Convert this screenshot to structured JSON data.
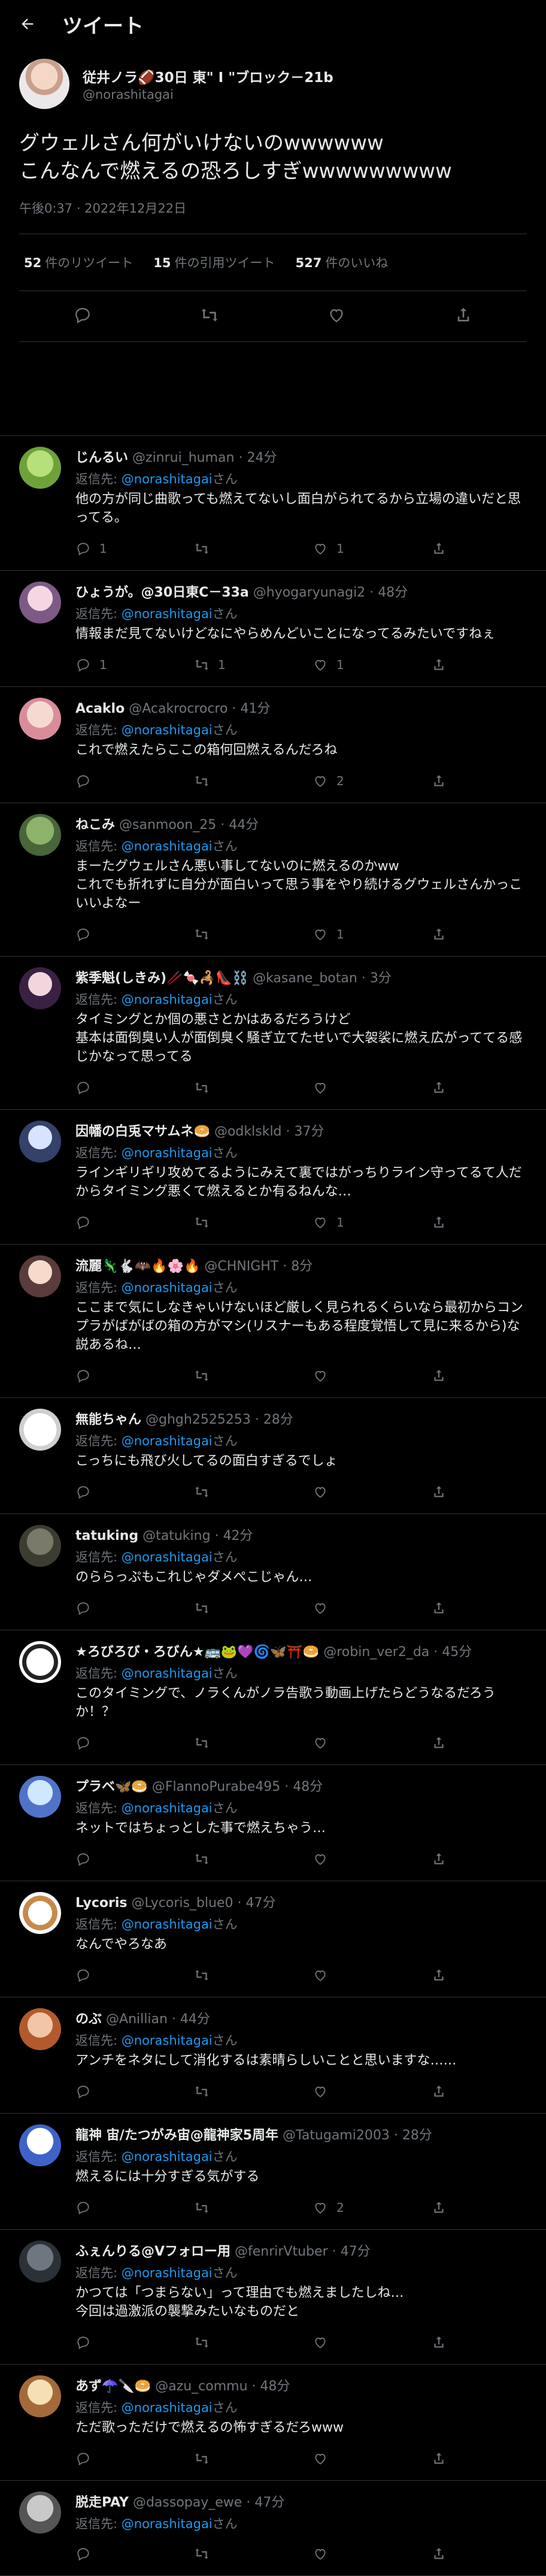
{
  "header": {
    "title": "ツイート"
  },
  "tweet": {
    "author_name": "従井ノラ🏈30日 東\" I \"ブロック－21b",
    "author_handle": "@norashitagai",
    "text": "グウェルさん何がいけないのwwwwww\nこんなんで燃えるの恐ろしすぎwwwwwwwww",
    "timestamp": "午後0:37 · 2022年12月22日",
    "retweets": "52",
    "retweets_label": "件のリツイート",
    "quotes": "15",
    "quotes_label": "件の引用ツイート",
    "likes": "527",
    "likes_label": "件のいいね"
  },
  "icons": [
    "back-arrow-icon",
    "reply-icon",
    "retweet-icon",
    "like-icon",
    "share-icon"
  ],
  "colors": {
    "background": "#000000",
    "text": "#e7e9ea",
    "muted": "#71767b",
    "accent": "#1d9bf0",
    "divider": "#2f3336"
  },
  "replies": [
    {
      "name": "じんるい",
      "handle": "@zinrui_human",
      "time": "24分",
      "to_prefix": "返信先: ",
      "to": "@norashitagai",
      "to_suffix": "さん",
      "text": "他の方が同じ曲歌っても燃えてないし面白がられてるから立場の違いだと思ってる。",
      "reply": "1",
      "retweet": "",
      "like": "1"
    },
    {
      "name": "ひょうが。@30日東C－33a",
      "handle": "@hyogaryunagi2",
      "time": "48分",
      "to_prefix": "返信先: ",
      "to": "@norashitagai",
      "to_suffix": "さん",
      "text": "情報まだ見てないけどなにやらめんどいことになってるみたいですねぇ",
      "reply": "1",
      "retweet": "1",
      "like": "1"
    },
    {
      "name": "Acaklo",
      "handle": "@Acakrocrocro",
      "time": "41分",
      "to_prefix": "返信先: ",
      "to": "@norashitagai",
      "to_suffix": "さん",
      "text": "これで燃えたらここの箱何回燃えるんだろね",
      "reply": "",
      "retweet": "",
      "like": "2"
    },
    {
      "name": "ねこみ",
      "handle": "@sanmoon_25",
      "time": "44分",
      "to_prefix": "返信先: ",
      "to": "@norashitagai",
      "to_suffix": "さん",
      "text": "まーたグウェルさん悪い事してないのに燃えるのかww\nこれでも折れずに自分が面白いって思う事をやり続けるグウェルさんかっこいいよなー",
      "reply": "",
      "retweet": "",
      "like": "1"
    },
    {
      "name": "紫季魁(しきみ)🥢🍬🦂👠⛓️",
      "handle": "@kasane_botan",
      "time": "3分",
      "to_prefix": "返信先: ",
      "to": "@norashitagai",
      "to_suffix": "さん",
      "text": "タイミングとか個の悪さとかはあるだろうけど\n基本は面倒臭い人が面倒臭く騒ぎ立てたせいで大袈裟に燃え広がっててる感じかなって思ってる",
      "reply": "",
      "retweet": "",
      "like": ""
    },
    {
      "name": "因幡の白兎マサムネ🥯",
      "handle": "@odklskld",
      "time": "37分",
      "to_prefix": "返信先: ",
      "to": "@norashitagai",
      "to_suffix": "さん",
      "text": "ラインギリギリ攻めてるようにみえて裏ではがっちりライン守ってるて人だからタイミング悪くて燃えるとか有るねんな…",
      "reply": "",
      "retweet": "",
      "like": "1"
    },
    {
      "name": "流麗🦎🐇🦇🔥🌸🔥",
      "handle": "@CHNIGHT",
      "time": "8分",
      "to_prefix": "返信先: ",
      "to": "@norashitagai",
      "to_suffix": "さん",
      "text": "ここまで気にしなきゃいけないほど厳しく見られるくらいなら最初からコンプラがばがばの箱の方がマシ(リスナーもある程度覚悟して見に来るから)な説あるね…",
      "reply": "",
      "retweet": "",
      "like": ""
    },
    {
      "name": "無能ちゃん",
      "handle": "@ghgh2525253",
      "time": "28分",
      "to_prefix": "返信先: ",
      "to": "@norashitagai",
      "to_suffix": "さん",
      "text": "こっちにも飛び火してるの面白すぎるでしょ",
      "reply": "",
      "retweet": "",
      "like": ""
    },
    {
      "name": "tatuking",
      "handle": "@tatuking",
      "time": "42分",
      "to_prefix": "返信先: ",
      "to": "@norashitagai",
      "to_suffix": "さん",
      "text": "のららっぷもこれじゃダメぺこじゃん…",
      "reply": "",
      "retweet": "",
      "like": ""
    },
    {
      "name": "★ろびろび・ろびん★🚌🐸💜🌀🦋⛩️🥯",
      "handle": "@robin_ver2_da",
      "time": "45分",
      "to_prefix": "返信先: ",
      "to": "@norashitagai",
      "to_suffix": "さん",
      "text": "このタイミングで、ノラくんがノラ告歌う動画上げたらどうなるだろうか！？",
      "reply": "",
      "retweet": "",
      "like": ""
    },
    {
      "name": "プラベ🦋🥯",
      "handle": "@FlannoPurabe495",
      "time": "48分",
      "to_prefix": "返信先: ",
      "to": "@norashitagai",
      "to_suffix": "さん",
      "text": "ネットではちょっとした事で燃えちゃう…",
      "reply": "",
      "retweet": "",
      "like": ""
    },
    {
      "name": "Lycoris",
      "handle": "@Lycoris_blue0",
      "time": "47分",
      "to_prefix": "返信先: ",
      "to": "@norashitagai",
      "to_suffix": "さん",
      "text": "なんでやろなあ",
      "reply": "",
      "retweet": "",
      "like": ""
    },
    {
      "name": "のぶ",
      "handle": "@Anillian",
      "time": "44分",
      "to_prefix": "返信先: ",
      "to": "@norashitagai",
      "to_suffix": "さん",
      "text": "アンチをネタにして消化するは素晴らしいことと思いますな……",
      "reply": "",
      "retweet": "",
      "like": ""
    },
    {
      "name": "龍神 宙/たつがみ宙@龍神家5周年",
      "handle": "@Tatugami2003",
      "time": "28分",
      "to_prefix": "返信先: ",
      "to": "@norashitagai",
      "to_suffix": "さん",
      "text": "燃えるには十分すぎる気がする",
      "reply": "",
      "retweet": "",
      "like": "2"
    },
    {
      "name": "ふぇんりる@Vフォロー用",
      "handle": "@fenrirVtuber",
      "time": "47分",
      "to_prefix": "返信先: ",
      "to": "@norashitagai",
      "to_suffix": "さん",
      "text": "かつては「つまらない」って理由でも燃えましたしね…\n今回は過激派の襲撃みたいなものだと",
      "reply": "",
      "retweet": "",
      "like": ""
    },
    {
      "name": "あず☂️🔪🥯",
      "handle": "@azu_commu",
      "time": "48分",
      "to_prefix": "返信先: ",
      "to": "@norashitagai",
      "to_suffix": "さん",
      "text": "ただ歌っただけで燃えるの怖すぎるだろwww",
      "reply": "",
      "retweet": "",
      "like": ""
    },
    {
      "name": "脱走PAY",
      "handle": "@dassopay_ewe",
      "time": "47分",
      "to_prefix": "返信先: ",
      "to": "@norashitagai",
      "to_suffix": "さん",
      "text": "",
      "reply": "",
      "retweet": "",
      "like": ""
    }
  ]
}
